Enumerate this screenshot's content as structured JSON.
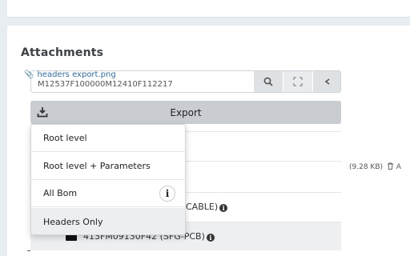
{
  "attachments": {
    "title": "Attachments",
    "file_name": "headers export.png",
    "file_size": "(9.28 KB)",
    "file_extra": "A"
  },
  "search": {
    "value": "M12537F100000M12410F112217"
  },
  "export": {
    "label": "Export",
    "menu": [
      {
        "label": "Root level"
      },
      {
        "label": "Root level + Parameters"
      },
      {
        "label": "All Bom"
      },
      {
        "label": "Headers Only"
      }
    ]
  },
  "rows": {
    "cable_text": "CABLE)",
    "part_text": "413FM09130F42 (SFG-PCB)"
  },
  "icons": {
    "clip": "paperclip-icon",
    "search": "search-icon",
    "expand": "expand-icon",
    "collapse": "chevron-icon",
    "download": "download-icon",
    "info": "info-icon",
    "trash": "trash-icon"
  }
}
